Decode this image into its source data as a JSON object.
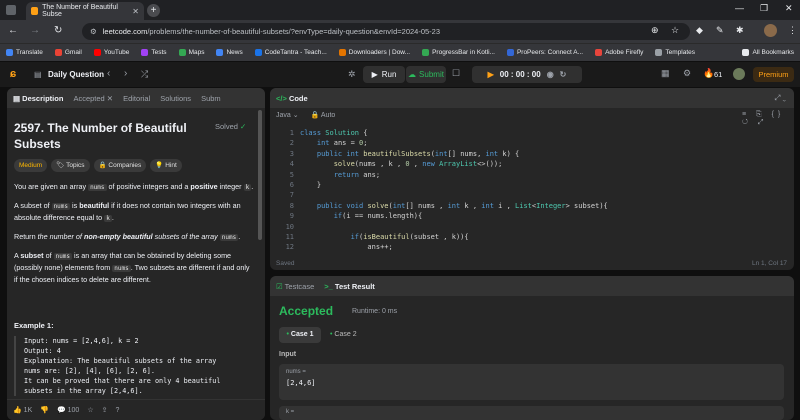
{
  "browser": {
    "tab_title": "The Number of Beautiful Subse",
    "url_host": "leetcode.com",
    "url_path": "/problems/the-number-of-beautiful-subsets/?envType=daily-question&envId=2024-05-23"
  },
  "bookmarks": [
    "Translate",
    "Gmail",
    "YouTube",
    "Tests",
    "Maps",
    "News",
    "CodeTantra - Teach...",
    "Downloaders | Dow...",
    "ProgressBar in Kotli...",
    "ProPeers: Connect A...",
    "Adobe Firefly",
    "Templates",
    "All Bookmarks"
  ],
  "bookmark_colors": [
    "#4285f4",
    "#ea4335",
    "#ff0000",
    "#a142f4",
    "#34a853",
    "#4285f4",
    "#1a73e8",
    "#e37400",
    "#34a853",
    "#3367d6",
    "#e8453c",
    "#9aa0a6",
    "#e8eaed"
  ],
  "nav": {
    "title": "Daily Question",
    "run": "Run",
    "submit": "Submit",
    "timer": "00 : 00 : 00",
    "streak": "61",
    "premium": "Premium"
  },
  "left": {
    "tabs": [
      "Description",
      "Accepted",
      "Editorial",
      "Solutions",
      "Subm"
    ],
    "title": "2597. The Number of Beautiful Subsets",
    "solved": "Solved",
    "tags": [
      "Medium",
      "Topics",
      "Companies",
      "Hint"
    ],
    "desc": {
      "p1a": "You are given an array ",
      "p1b": "nums",
      "p1c": " of positive integers and a ",
      "p1d": "positive",
      "p1e": " integer ",
      "p1f": "k",
      "p2a": "A subset of ",
      "p2b": "nums",
      "p2c": " is ",
      "p2d": "beautiful",
      "p2e": " if it does not contain two integers with an absolute difference equal to ",
      "p2f": "k",
      "p3a": "Return ",
      "p3b": "the number of ",
      "p3c": "non-empty beautiful",
      "p3d": " subsets of the array ",
      "p3e": "nums",
      "p4a": "A ",
      "p4b": "subset",
      "p4c": " of ",
      "p4d": "nums",
      "p4e": " is an array that can be obtained by deleting some (possibly none) elements from ",
      "p4f": "nums",
      "p4g": ". Two subsets are different if and only if the chosen indices to delete are different."
    },
    "example_title": "Example 1:",
    "example_lines": [
      "Input: nums = [2,4,6], k = 2",
      "Output: 4",
      "Explanation: The beautiful subsets of the array",
      "nums are: [2], [4], [6], [2, 6].",
      "It can be proved that there are only 4 beautiful",
      "subsets in the array [2,4,6]."
    ],
    "likes": "1K",
    "comments": "100"
  },
  "code": {
    "title": "Code",
    "lang": "Java",
    "mode": "Auto",
    "status": "Saved",
    "cursor": "Ln 1, Col 17",
    "line_numbers": [
      "1",
      "2",
      "3",
      "4",
      "5",
      "6",
      "7",
      "8",
      "9",
      "10",
      "11",
      "12"
    ]
  },
  "result": {
    "tabs": [
      "Testcase",
      "Test Result"
    ],
    "verdict": "Accepted",
    "runtime": "Runtime: 0 ms",
    "case1": "Case 1",
    "case2": "Case 2",
    "input_label": "Input",
    "var1_name": "nums =",
    "var1_value": "[2,4,6]",
    "var2_name": "k ="
  }
}
